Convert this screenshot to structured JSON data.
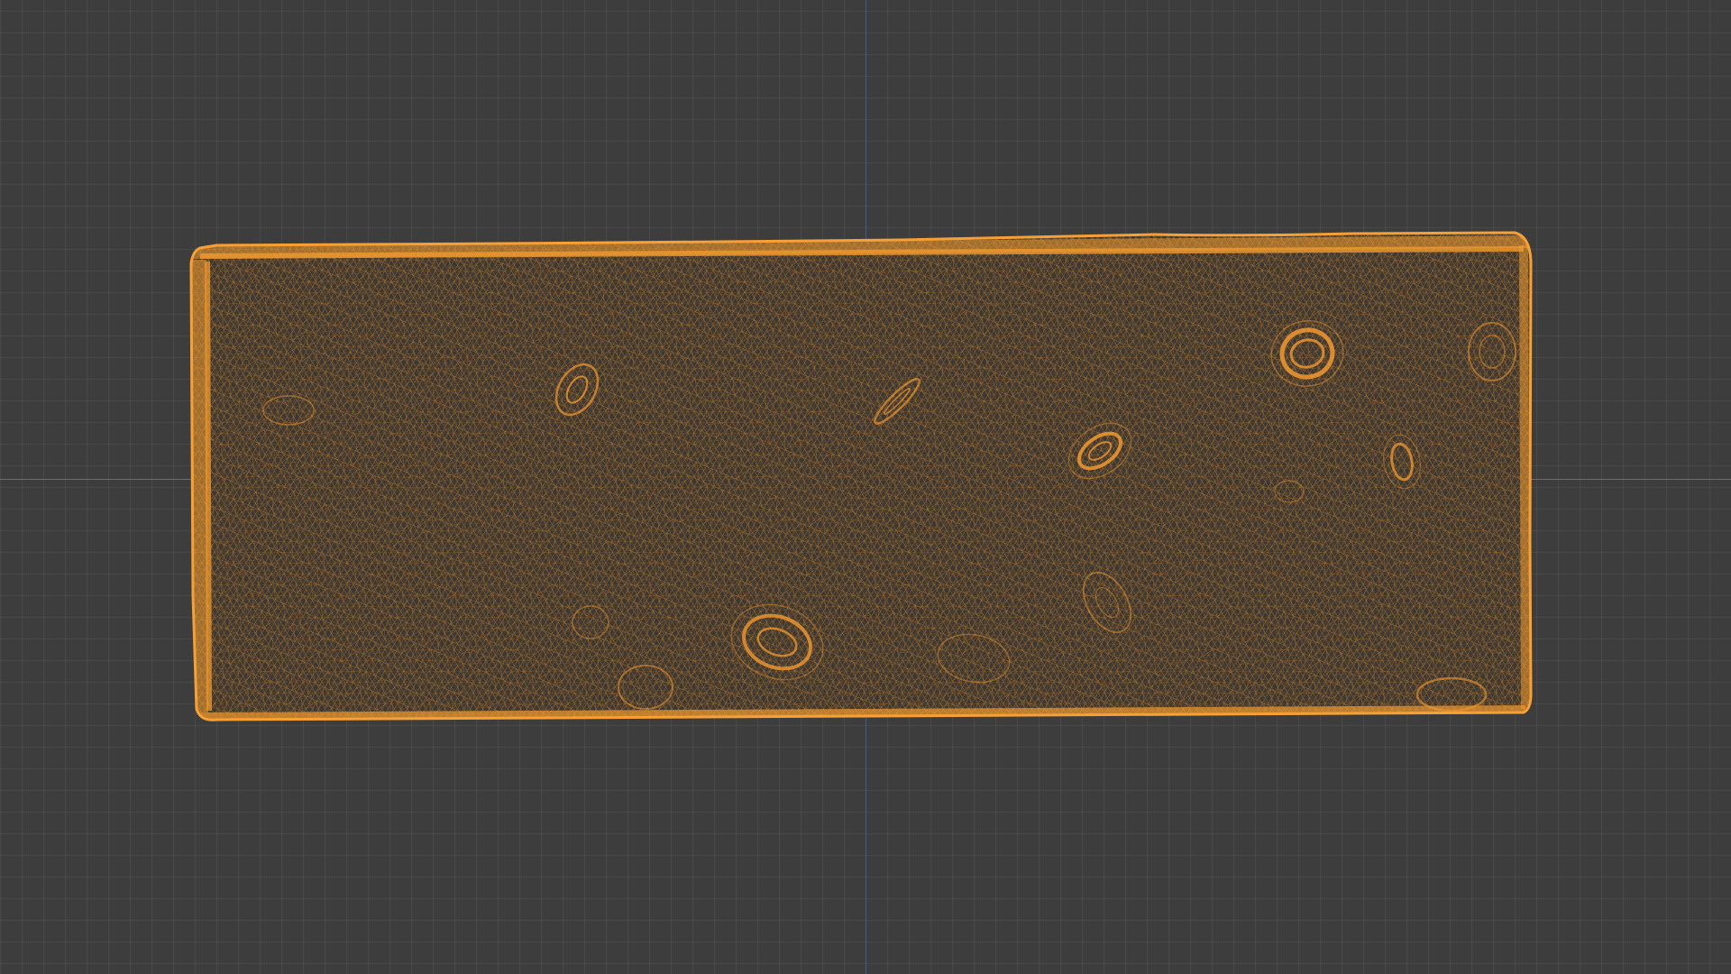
{
  "viewport": {
    "view_mode": "wireframe",
    "object": "brick mesh",
    "colors": {
      "background": "#3d3d3d",
      "grid": "#4a4a4a",
      "x_axis": "#5f7c3a",
      "y_axis": "#3e5c8a",
      "wire_selected": "#f0952a",
      "mesh_fill": "#3a3632"
    }
  }
}
